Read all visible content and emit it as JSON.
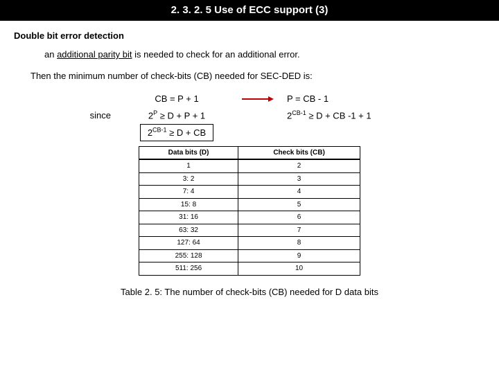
{
  "header": {
    "title": "2. 3. 2. 5 Use of ECC support (3)"
  },
  "subhead": "Double bit error detection",
  "para1": {
    "pre": "an ",
    "underline": "additional parity bit",
    "post": " is needed to check for an additional error."
  },
  "para2": "Then the minimum number of check-bits (CB) needed for SEC-DED is:",
  "eq": {
    "row1_left": "CB = P + 1",
    "row1_right": "P = CB - 1",
    "since": "since",
    "row2_left_base": "2",
    "row2_left_sup": "P",
    "row2_left_rest": " ≥ D + P + 1",
    "row2_right_base": "2",
    "row2_right_sup": "CB-1",
    "row2_right_rest": " ≥ D + CB -1 + 1",
    "final_base": "2",
    "final_sup": "CB-1",
    "final_rest": " ≥ D + CB"
  },
  "table": {
    "headers": [
      "Data bits (D)",
      "Check bits (CB)"
    ],
    "rows": [
      [
        "1",
        "2"
      ],
      [
        "3: 2",
        "3"
      ],
      [
        "7: 4",
        "4"
      ],
      [
        "15: 8",
        "5"
      ],
      [
        "31: 16",
        "6"
      ],
      [
        "63: 32",
        "7"
      ],
      [
        "127: 64",
        "8"
      ],
      [
        "255: 128",
        "9"
      ],
      [
        "511: 256",
        "10"
      ]
    ]
  },
  "caption": "Table 2. 5: The number of check-bits (CB) needed for D data bits",
  "chart_data": {
    "type": "table",
    "title": "Check-bits needed for SEC-DED",
    "columns": [
      "Data bits (D)",
      "Check bits (CB)"
    ],
    "rows": [
      {
        "D": "1",
        "CB": 2
      },
      {
        "D": "3:2",
        "CB": 3
      },
      {
        "D": "7:4",
        "CB": 4
      },
      {
        "D": "15:8",
        "CB": 5
      },
      {
        "D": "31:16",
        "CB": 6
      },
      {
        "D": "63:32",
        "CB": 7
      },
      {
        "D": "127:64",
        "CB": 8
      },
      {
        "D": "255:128",
        "CB": 9
      },
      {
        "D": "511:256",
        "CB": 10
      }
    ]
  }
}
